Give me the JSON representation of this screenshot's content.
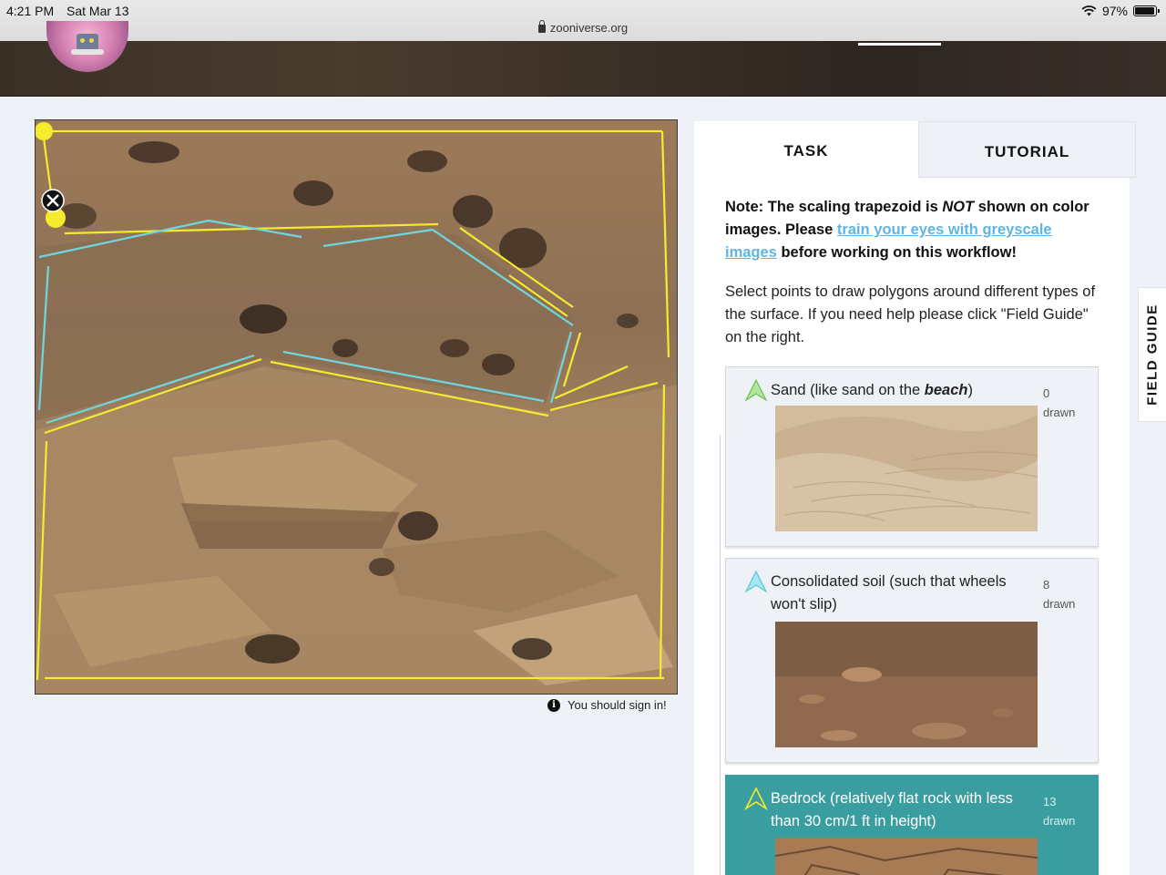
{
  "status_bar": {
    "time": "4:21 PM",
    "date": "Sat Mar 13",
    "url": "zooniverse.org",
    "battery": "97%",
    "icons": [
      "lock-icon",
      "wifi-icon",
      "battery-icon"
    ]
  },
  "header": {
    "avatar_icon": "project-avatar",
    "active_nav_color": "#ffffff"
  },
  "subject": {
    "signin_notice": "You should sign in!",
    "info_icon_glyph": "i",
    "annotation_colors": {
      "yellow": "#f5eb2d",
      "cyan": "#6fd6e0"
    },
    "delete_icon": "close-circle-icon"
  },
  "tabs": {
    "task": "TASK",
    "tutorial": "TUTORIAL"
  },
  "task": {
    "note_part1": "Note: The scaling trapezoid is ",
    "note_emph": "NOT",
    "note_part2": " shown on color images. Please ",
    "note_link": "train your eyes with greyscale images",
    "note_part3": " before working on this workflow!",
    "instructions": "Select points to draw polygons around different types of the surface. If you need help please click \"Field Guide\" on the right.",
    "choices": [
      {
        "label_pre": "Sand (like sand on the ",
        "label_emph": "beach",
        "label_post": ")",
        "count": "0",
        "count_label": "drawn",
        "color": "#9ed97a",
        "icon": "triangle-icon"
      },
      {
        "label_pre": "Consolidated soil (such that wheels won't slip)",
        "label_emph": "",
        "label_post": "",
        "count": "8",
        "count_label": "drawn",
        "color": "#7fdae6",
        "icon": "triangle-icon"
      },
      {
        "label_pre": "Bedrock (relatively flat rock with less than 30 cm/1 ft in height)",
        "label_emph": "",
        "label_post": "",
        "count": "13",
        "count_label": "drawn",
        "color": "#f5eb2d",
        "icon": "triangle-icon"
      }
    ]
  },
  "field_guide": "FIELD GUIDE"
}
